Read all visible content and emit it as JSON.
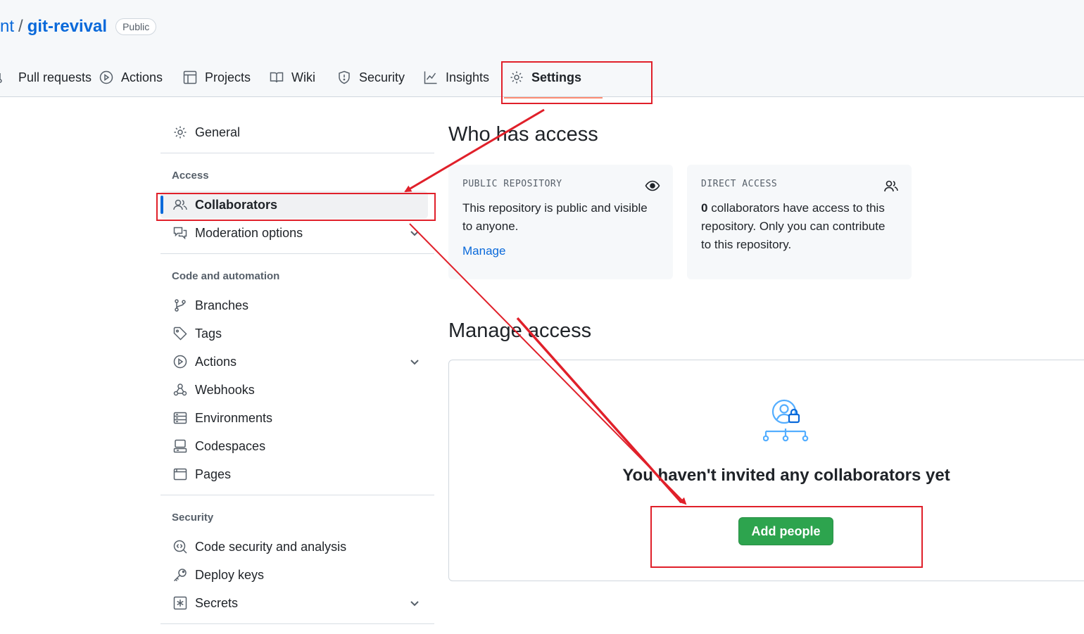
{
  "repo": {
    "owner_fragment": "nt",
    "separator": "/",
    "name": "git-revival",
    "visibility": "Public"
  },
  "tabs": [
    {
      "label": "Pull requests",
      "icon": "pull-request-icon"
    },
    {
      "label": "Actions",
      "icon": "play-icon"
    },
    {
      "label": "Projects",
      "icon": "table-icon"
    },
    {
      "label": "Wiki",
      "icon": "book-icon"
    },
    {
      "label": "Security",
      "icon": "shield-icon"
    },
    {
      "label": "Insights",
      "icon": "graph-icon"
    },
    {
      "label": "Settings",
      "icon": "gear-icon",
      "selected": true
    }
  ],
  "sidebar": {
    "general": "General",
    "access_heading": "Access",
    "collaborators": "Collaborators",
    "moderation": "Moderation options",
    "code_heading": "Code and automation",
    "branches": "Branches",
    "tags": "Tags",
    "actions": "Actions",
    "webhooks": "Webhooks",
    "environments": "Environments",
    "codespaces": "Codespaces",
    "pages": "Pages",
    "security_heading": "Security",
    "code_security": "Code security and analysis",
    "deploy_keys": "Deploy keys",
    "secrets": "Secrets"
  },
  "main": {
    "who_heading": "Who has access",
    "public_card": {
      "title": "PUBLIC REPOSITORY",
      "text": "This repository is public and visible to anyone.",
      "link": "Manage"
    },
    "direct_card": {
      "title": "DIRECT ACCESS",
      "count": "0",
      "text": " collaborators have access to this repository. Only you can contribute to this repository."
    },
    "manage_heading": "Manage access",
    "empty_text": "You haven't invited any collaborators yet",
    "add_button": "Add people"
  },
  "colors": {
    "accent": "#0969da",
    "primary_button": "#2da44e",
    "annotation": "#e0202a",
    "selected_tab_underline": "#fd8c73"
  }
}
